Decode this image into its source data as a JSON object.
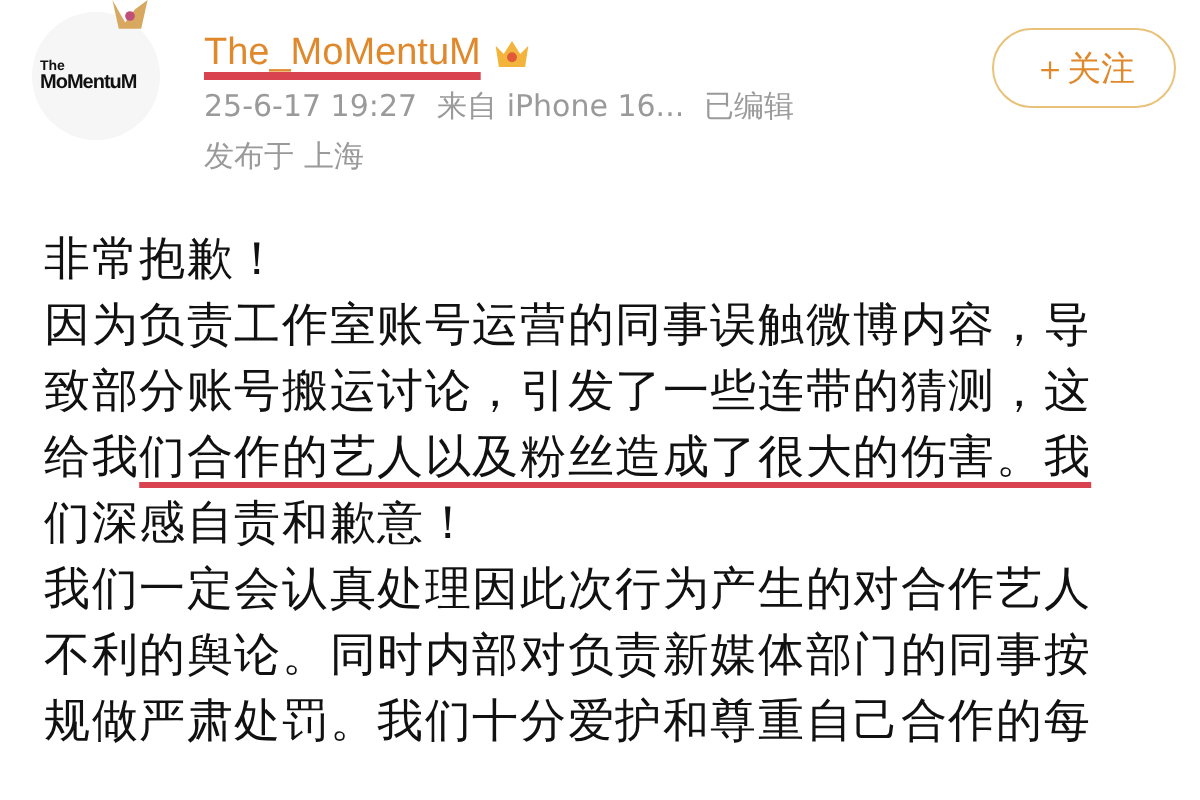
{
  "author": {
    "avatar_logo": [
      "The",
      "MoMentuM"
    ],
    "name": "The_MoMentuM",
    "name_underlined": true,
    "time": "25-6-17 19:27",
    "source": "来自 iPhone 16...",
    "edited": "已编辑",
    "location": "发布于 上海"
  },
  "follow_button": "＋关注",
  "body_lines": [
    {
      "segments": [
        {
          "text": "非常抱歉！",
          "underlined": false
        }
      ]
    },
    {
      "segments": [
        {
          "text": "因为负责工作室账号运营的同事误触微博内容，导",
          "underlined": false
        }
      ]
    },
    {
      "segments": [
        {
          "text": "致部分账号搬运讨论，引发了一些连带的猜测，这",
          "underlined": false
        }
      ]
    },
    {
      "segments": [
        {
          "text": "给我",
          "underlined": false
        },
        {
          "text": "们合作的艺人以及粉丝造成了很大的伤害。我",
          "underlined": true
        }
      ]
    },
    {
      "segments": [
        {
          "text": "们深感自责和歉意！",
          "underlined": false
        }
      ]
    },
    {
      "segments": [
        {
          "text": "我们一定会认真处理因此次行为产生的对合作艺人",
          "underlined": false
        }
      ]
    },
    {
      "segments": [
        {
          "text": "不利的舆论。同时内部对负责新媒体部门的同事按",
          "underlined": false
        }
      ]
    },
    {
      "segments": [
        {
          "text": "规做严肃处罚。我们十分爱护和尊重自己合作的每",
          "underlined": false
        }
      ]
    }
  ]
}
